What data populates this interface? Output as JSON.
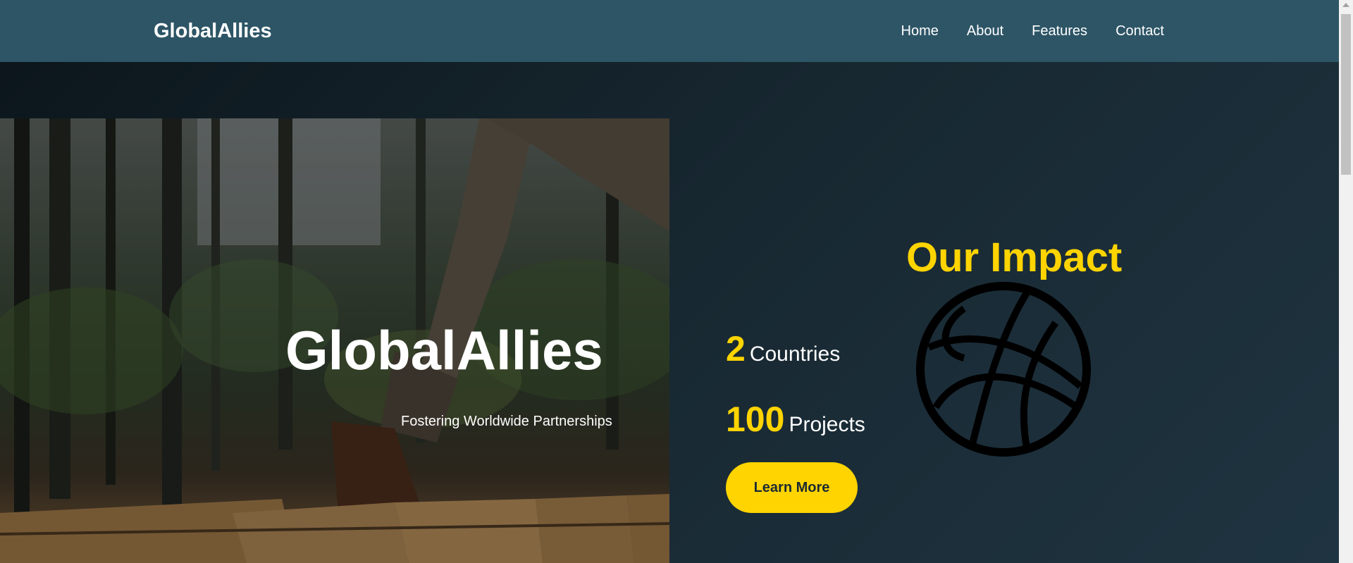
{
  "header": {
    "brand": "GlobalAllies",
    "nav": [
      {
        "label": "Home"
      },
      {
        "label": "About"
      },
      {
        "label": "Features"
      },
      {
        "label": "Contact"
      }
    ]
  },
  "hero": {
    "title": "GlobalAllies",
    "subtitle": "Fostering Worldwide Partnerships",
    "image_icon": "forest-hiker-photo"
  },
  "impact": {
    "title": "Our Impact",
    "icon": "globe-icon",
    "stats": [
      {
        "number": "2",
        "label": "Countries"
      },
      {
        "number": "100",
        "label": "Projects"
      }
    ],
    "button_label": "Learn More"
  },
  "colors": {
    "header_bg": "#2d5566",
    "accent": "#ffd400",
    "hero_bg": "#172730"
  }
}
